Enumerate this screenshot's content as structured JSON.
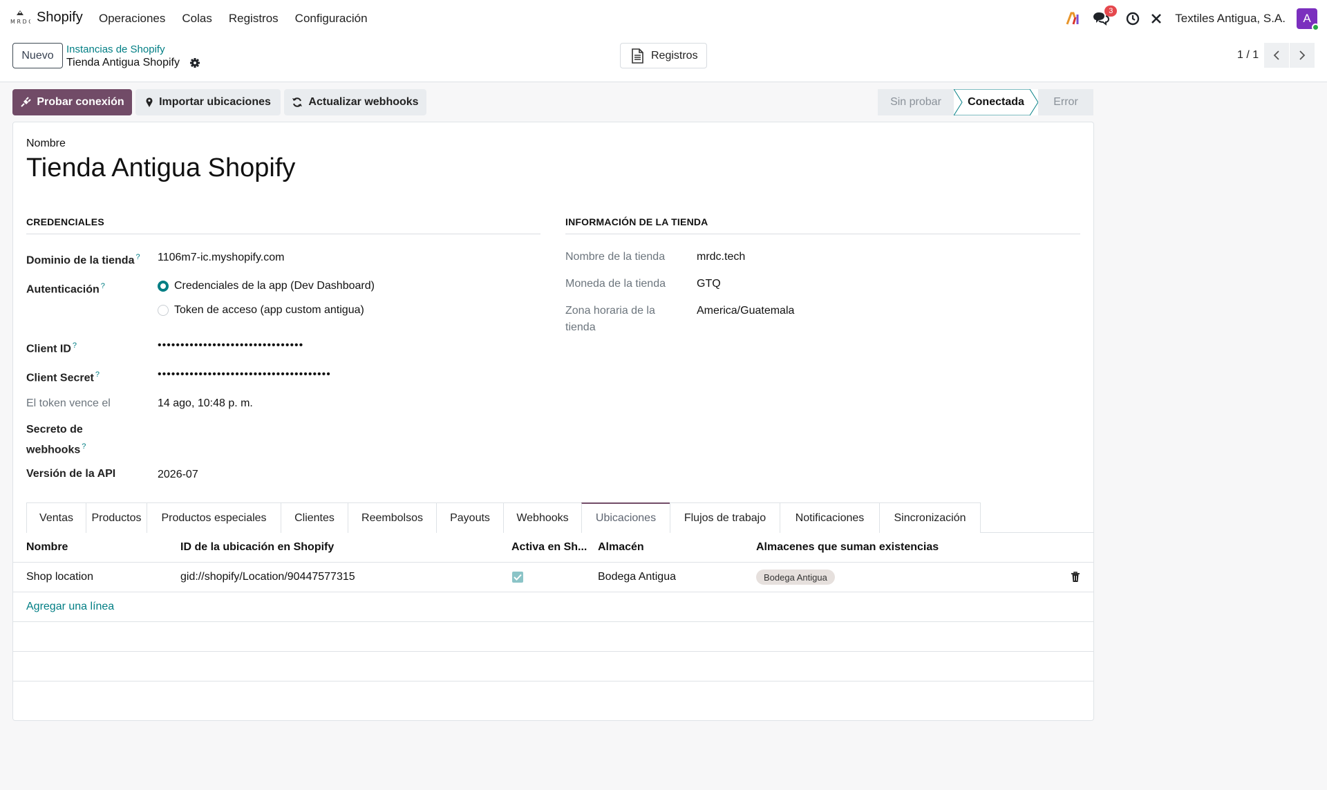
{
  "navbar": {
    "app_name": "Shopify",
    "menu": [
      "Operaciones",
      "Colas",
      "Registros",
      "Configuración"
    ],
    "messages_count": "3",
    "company": "Textiles Antigua, S.A.",
    "avatar_letter": "A"
  },
  "control": {
    "new_button": "Nuevo",
    "breadcrumb_parent": "Instancias de Shopify",
    "breadcrumb_current": "Tienda Antigua Shopify",
    "logs_button": "Registros",
    "pager": "1 / 1"
  },
  "actions": {
    "test_connection": "Probar conexión",
    "import_locations": "Importar ubicaciones",
    "update_webhooks": "Actualizar webhooks"
  },
  "status": {
    "steps": [
      "Sin probar",
      "Conectada",
      "Error"
    ],
    "current": "Conectada"
  },
  "form": {
    "name_label": "Nombre",
    "name": "Tienda Antigua Shopify",
    "credentials": {
      "heading": "CREDENCIALES",
      "domain_label": "Dominio de la tienda",
      "domain": "1106m7-ic.myshopify.com",
      "auth_label": "Autenticación",
      "auth_options": [
        "Credenciales de la app (Dev Dashboard)",
        "Token de acceso (app custom antigua)"
      ],
      "auth_selected": "Credenciales de la app (Dev Dashboard)",
      "client_id_label": "Client ID",
      "client_id": "••••••••••••••••••••••••••••••••",
      "client_secret_label": "Client Secret",
      "client_secret": "••••••••••••••••••••••••••••••••••••••",
      "token_expiry_label": "El token vence el",
      "token_expiry": "14 ago, 10:48 p. m.",
      "webhook_secret_label_1": "Secreto de",
      "webhook_secret_label_2": "webhooks",
      "api_version_label": "Versión de la API",
      "api_version": "2026-07"
    },
    "store_info": {
      "heading": "INFORMACIÓN DE LA TIENDA",
      "store_name_label": "Nombre de la tienda",
      "store_name": "mrdc.tech",
      "currency_label": "Moneda de la tienda",
      "currency": "GTQ",
      "timezone_label_1": "Zona horaria de la",
      "timezone_label_2": "tienda",
      "timezone": "America/Guatemala"
    }
  },
  "tabs": [
    "Ventas",
    "Productos",
    "Productos especiales",
    "Clientes",
    "Reembolsos",
    "Payouts",
    "Webhooks",
    "Ubicaciones",
    "Flujos de trabajo",
    "Notificaciones",
    "Sincronización"
  ],
  "active_tab": "Ubicaciones",
  "table": {
    "headers": [
      "Nombre",
      "ID de la ubicación en Shopify",
      "Activa en Sh...",
      "Almacén",
      "Almacenes que suman existencias"
    ],
    "rows": [
      {
        "name": "Shop location",
        "shopify_id": "gid://shopify/Location/90447577315",
        "active": true,
        "warehouse": "Bodega Antigua",
        "sum_warehouses": [
          "Bodega Antigua"
        ]
      }
    ],
    "add_line": "Agregar una línea"
  },
  "colors": {
    "primary": "#714b67",
    "link": "#017e84",
    "badge": "#e5484d",
    "avatar": "#7b2fbe"
  }
}
